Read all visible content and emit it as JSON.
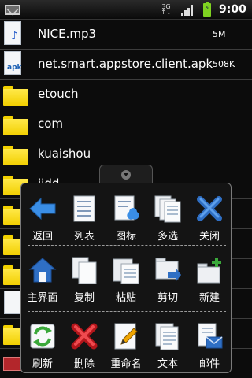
{
  "statusbar": {
    "time": "9:00",
    "icons": [
      "mail-icon",
      "network-3g-icon",
      "signal-icon",
      "battery-charging-icon"
    ]
  },
  "files": [
    {
      "name": "NICE.mp3",
      "size": "5M",
      "icon": "audio-file-icon"
    },
    {
      "name": "net.smart.appstore.client.apk",
      "size": "508K",
      "icon": "apk-file-icon"
    },
    {
      "name": "etouch",
      "size": "",
      "icon": "folder-icon"
    },
    {
      "name": "com",
      "size": "",
      "icon": "folder-icon"
    },
    {
      "name": "kuaishou",
      "size": "",
      "icon": "folder-icon"
    },
    {
      "name": "jidd",
      "size": "",
      "icon": "folder-icon"
    }
  ],
  "menu": {
    "rows": [
      [
        {
          "label": "返回",
          "icon": "back-arrow-icon"
        },
        {
          "label": "列表",
          "icon": "list-icon"
        },
        {
          "label": "图标",
          "icon": "icon-view-icon"
        },
        {
          "label": "多选",
          "icon": "multi-select-icon"
        },
        {
          "label": "关闭",
          "icon": "close-icon"
        }
      ],
      [
        {
          "label": "主界面",
          "icon": "home-icon"
        },
        {
          "label": "复制",
          "icon": "copy-icon"
        },
        {
          "label": "粘贴",
          "icon": "paste-icon"
        },
        {
          "label": "剪切",
          "icon": "cut-icon"
        },
        {
          "label": "新建",
          "icon": "new-folder-icon"
        }
      ],
      [
        {
          "label": "刷新",
          "icon": "refresh-icon"
        },
        {
          "label": "删除",
          "icon": "delete-icon"
        },
        {
          "label": "重命名",
          "icon": "rename-icon"
        },
        {
          "label": "文本",
          "icon": "text-icon"
        },
        {
          "label": "邮件",
          "icon": "mail-icon"
        }
      ]
    ]
  },
  "colors": {
    "accent_blue": "#3a8ee6",
    "folder_yellow": "#f2cf00",
    "delete_red": "#e0252b",
    "refresh_green": "#3aa83a"
  }
}
